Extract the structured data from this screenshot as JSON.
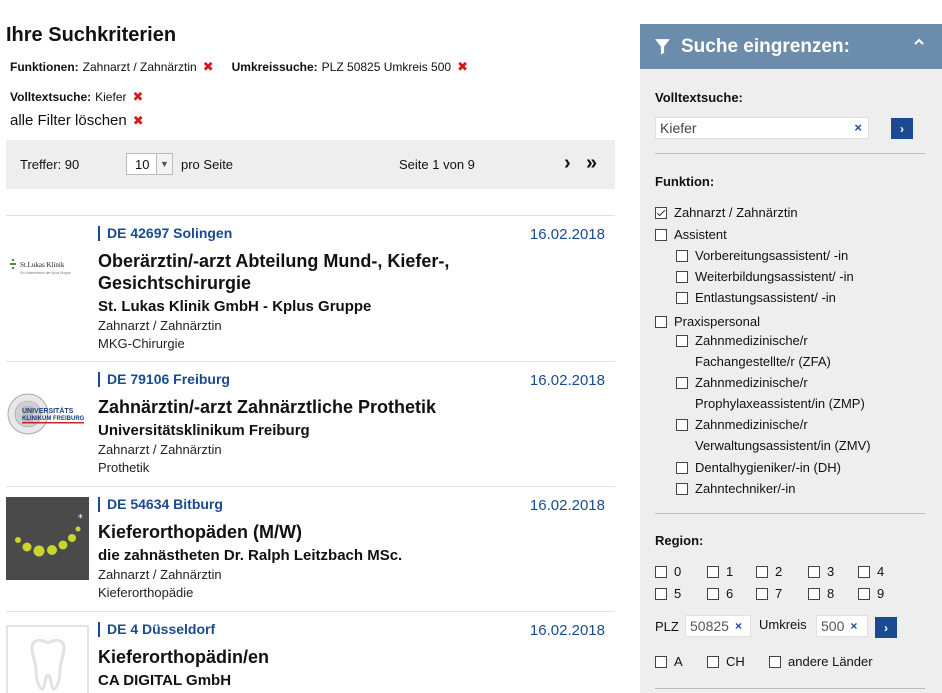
{
  "criteria": {
    "title": "Ihre Suchkriterien",
    "chips": [
      {
        "label": "Funktionen:",
        "value": "Zahnarzt / Zahnärztin"
      },
      {
        "label": "Umkreissuche:",
        "value": "PLZ 50825 Umkreis 500"
      },
      {
        "label": "Volltextsuche:",
        "value": "Kiefer"
      }
    ],
    "clear_all": "alle Filter löschen",
    "remove_glyph": "✖"
  },
  "pager": {
    "hits": "Treffer: 90",
    "per_page_value": "10",
    "per_page_label": "pro Seite",
    "page_info": "Seite 1 von 9",
    "next": "›",
    "last": "»"
  },
  "results": [
    {
      "location": "DE 42697 Solingen",
      "date": "16.02.2018",
      "title": "Oberärztin/-arzt Abteilung Mund-, Kiefer-, Gesichtschirurgie",
      "company": "St. Lukas Klinik GmbH - Kplus Gruppe",
      "function": "Zahnarzt / Zahnärztin",
      "field": "MKG-Chirurgie",
      "logo_name": "St.Lukas Klinik",
      "logo_sub": "Ein Unternehmen der Kplus Gruppe"
    },
    {
      "location": "DE 79106 Freiburg",
      "date": "16.02.2018",
      "title": "Zahnärztin/-arzt Zahnärztliche Prothetik",
      "company": "Universitätsklinikum Freiburg",
      "function": "Zahnarzt / Zahnärztin",
      "field": "Prothetik",
      "logo_name": "UNIVERSITÄTS",
      "logo_sub": "KLINIKUM FREIBURG"
    },
    {
      "location": "DE 54634 Bitburg",
      "date": "16.02.2018",
      "title": "Kieferorthopäden (M/W)",
      "company": "die zahnästheten Dr. Ralph Leitzbach MSc.",
      "function": "Zahnarzt / Zahnärztin",
      "field": "Kieferorthopädie"
    },
    {
      "location": "DE 4 Düsseldorf",
      "date": "16.02.2018",
      "title": "Kieferorthopädin/en",
      "company": "CA DIGITAL GmbH"
    }
  ],
  "sidebar": {
    "header": "Suche eingrenzen:",
    "fulltext_label": "Volltextsuche:",
    "fulltext_value": "Kiefer",
    "clear_glyph": "×",
    "go_glyph": "›",
    "function_label": "Funktion:",
    "functions": [
      {
        "label": "Zahnarzt / Zahnärztin",
        "checked": true,
        "level": 0
      },
      {
        "label": "Assistent",
        "checked": false,
        "level": 0
      },
      {
        "label": "Vorbereitungsassistent/ -in",
        "checked": false,
        "level": 1
      },
      {
        "label": "Weiterbildungsassistent/ -in",
        "checked": false,
        "level": 1
      },
      {
        "label": "Entlastungsassistent/ -in",
        "checked": false,
        "level": 1
      },
      {
        "label": "Praxispersonal",
        "checked": false,
        "level": 0
      },
      {
        "label": "Zahnmedizinische/r",
        "label2": "Fachangestellte/r (ZFA)",
        "checked": false,
        "level": 1
      },
      {
        "label": "Zahnmedizinische/r",
        "label2": "Prophylaxeassistent/in (ZMP)",
        "checked": false,
        "level": 1
      },
      {
        "label": "Zahnmedizinische/r",
        "label2": "Verwaltungsassistent/in (ZMV)",
        "checked": false,
        "level": 1
      },
      {
        "label": "Dentalhygieniker/-in (DH)",
        "checked": false,
        "level": 1
      },
      {
        "label": "Zahntechniker/-in",
        "checked": false,
        "level": 1
      }
    ],
    "region_label": "Region:",
    "regions": [
      "0",
      "1",
      "2",
      "3",
      "4",
      "5",
      "6",
      "7",
      "8",
      "9"
    ],
    "plz_label": "PLZ",
    "plz_value": "50825",
    "radius_label": "Umkreis",
    "radius_value": "500",
    "countries": [
      "A",
      "CH",
      "andere Länder"
    ]
  }
}
